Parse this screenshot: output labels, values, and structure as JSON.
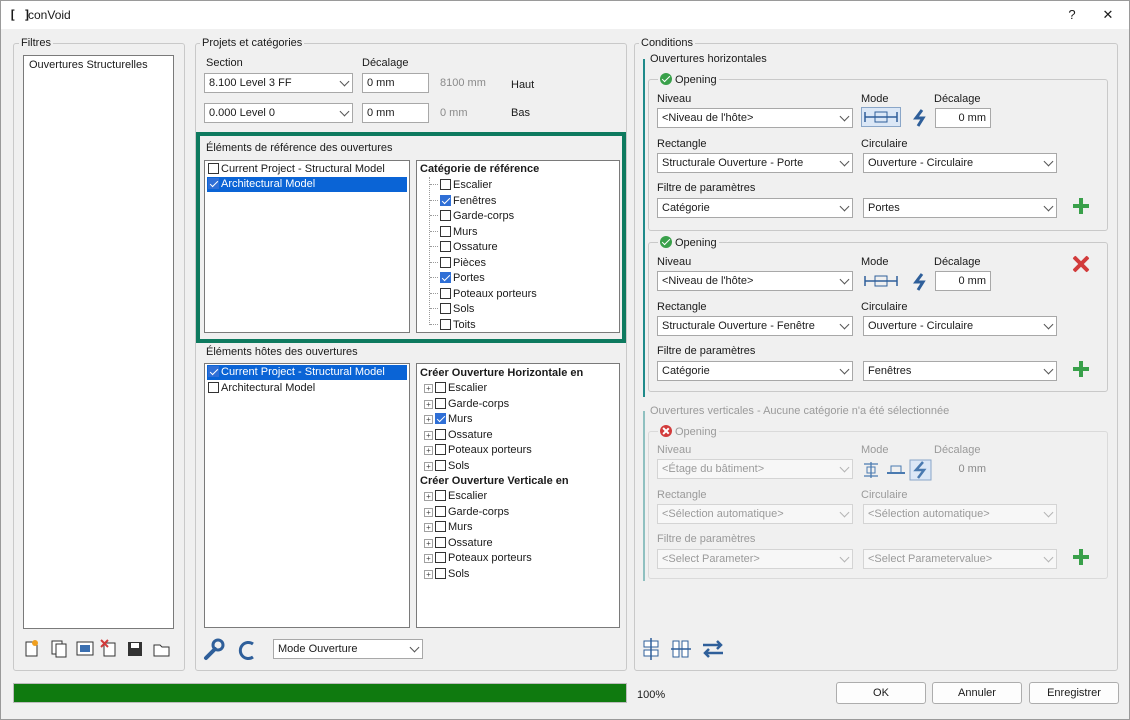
{
  "window": {
    "title": "conVoid",
    "help": "?",
    "close": "✕"
  },
  "filters": {
    "group_label": "Filtres",
    "items": [
      "Ouvertures Structurelles"
    ]
  },
  "projects": {
    "group_label": "Projets et catégories",
    "section_label": "Section",
    "offset_label": "Décalage",
    "top": {
      "level": "8.100  Level 3 FF",
      "offset": "0 mm",
      "computed": "8100 mm",
      "label": "Haut"
    },
    "bottom": {
      "level": "0.000  Level 0",
      "offset": "0 mm",
      "computed": "0 mm",
      "label": "Bas"
    }
  },
  "reference": {
    "group_label": "Éléments de référence des ouvertures",
    "models": [
      {
        "label": "Current Project - Structural Model",
        "checked": false
      },
      {
        "label": "Architectural Model",
        "checked": true
      }
    ],
    "category_header": "Catégorie de référence",
    "categories": [
      {
        "label": "Escalier",
        "checked": false
      },
      {
        "label": "Fenêtres",
        "checked": true
      },
      {
        "label": "Garde-corps",
        "checked": false
      },
      {
        "label": "Murs",
        "checked": false
      },
      {
        "label": "Ossature",
        "checked": false
      },
      {
        "label": "Pièces",
        "checked": false
      },
      {
        "label": "Portes",
        "checked": true
      },
      {
        "label": "Poteaux porteurs",
        "checked": false
      },
      {
        "label": "Sols",
        "checked": false
      },
      {
        "label": "Toits",
        "checked": false
      }
    ]
  },
  "hosts": {
    "group_label": "Éléments hôtes des ouvertures",
    "models": [
      {
        "label": "Current Project - Structural Model",
        "checked": true
      },
      {
        "label": "Architectural Model",
        "checked": false
      }
    ],
    "horizontal_header": "Créer Ouverture Horizontale en",
    "horizontal": [
      {
        "label": "Escalier",
        "checked": false
      },
      {
        "label": "Garde-corps",
        "checked": false
      },
      {
        "label": "Murs",
        "checked": true
      },
      {
        "label": "Ossature",
        "checked": false
      },
      {
        "label": "Poteaux porteurs",
        "checked": false
      },
      {
        "label": "Sols",
        "checked": false
      }
    ],
    "vertical_header": "Créer Ouverture Verticale en",
    "vertical": [
      {
        "label": "Escalier",
        "checked": false
      },
      {
        "label": "Garde-corps",
        "checked": false
      },
      {
        "label": "Murs",
        "checked": false
      },
      {
        "label": "Ossature",
        "checked": false
      },
      {
        "label": "Poteaux porteurs",
        "checked": false
      },
      {
        "label": "Sols",
        "checked": false
      }
    ]
  },
  "mode_select": "Mode Ouverture",
  "conditions": {
    "group_label": "Conditions",
    "horizontal_label": "Ouvertures horizontales",
    "opening1": {
      "title": "Opening",
      "niveau_label": "Niveau",
      "mode_label": "Mode",
      "offset_label": "Décalage",
      "niveau": "<Niveau de l'hôte>",
      "offset": "0 mm",
      "rect_label": "Rectangle",
      "circ_label": "Circulaire",
      "rect": "Structurale Ouverture - Porte",
      "circ": "Ouverture - Circulaire",
      "filter_label": "Filtre de paramètres",
      "filter_param": "Catégorie",
      "filter_value": "Portes"
    },
    "opening2": {
      "title": "Opening",
      "niveau_label": "Niveau",
      "mode_label": "Mode",
      "offset_label": "Décalage",
      "niveau": "<Niveau de l'hôte>",
      "offset": "0 mm",
      "rect_label": "Rectangle",
      "circ_label": "Circulaire",
      "rect": "Structurale Ouverture - Fenêtre",
      "circ": "Ouverture - Circulaire",
      "filter_label": "Filtre de paramètres",
      "filter_param": "Catégorie",
      "filter_value": "Fenêtres"
    },
    "vertical_label": "Ouvertures verticales - Aucune catégorie n'a été sélectionnée",
    "opening3": {
      "title": "Opening",
      "niveau_label": "Niveau",
      "mode_label": "Mode",
      "offset_label": "Décalage",
      "niveau": "<Étage du bâtiment>",
      "offset": "0 mm",
      "rect_label": "Rectangle",
      "circ_label": "Circulaire",
      "rect": "<Sélection automatique>",
      "circ": "<Sélection automatique>",
      "filter_label": "Filtre de paramètres",
      "filter_param": "<Select Parameter>",
      "filter_value": "<Select Parametervalue>"
    }
  },
  "progress": {
    "percent": 100,
    "label": "100%",
    "color": "#0f7a0f"
  },
  "buttons": {
    "ok": "OK",
    "cancel": "Annuler",
    "save": "Enregistrer"
  },
  "colors": {
    "highlight_border": "#0e7a5f",
    "selection": "#0a64d6"
  }
}
